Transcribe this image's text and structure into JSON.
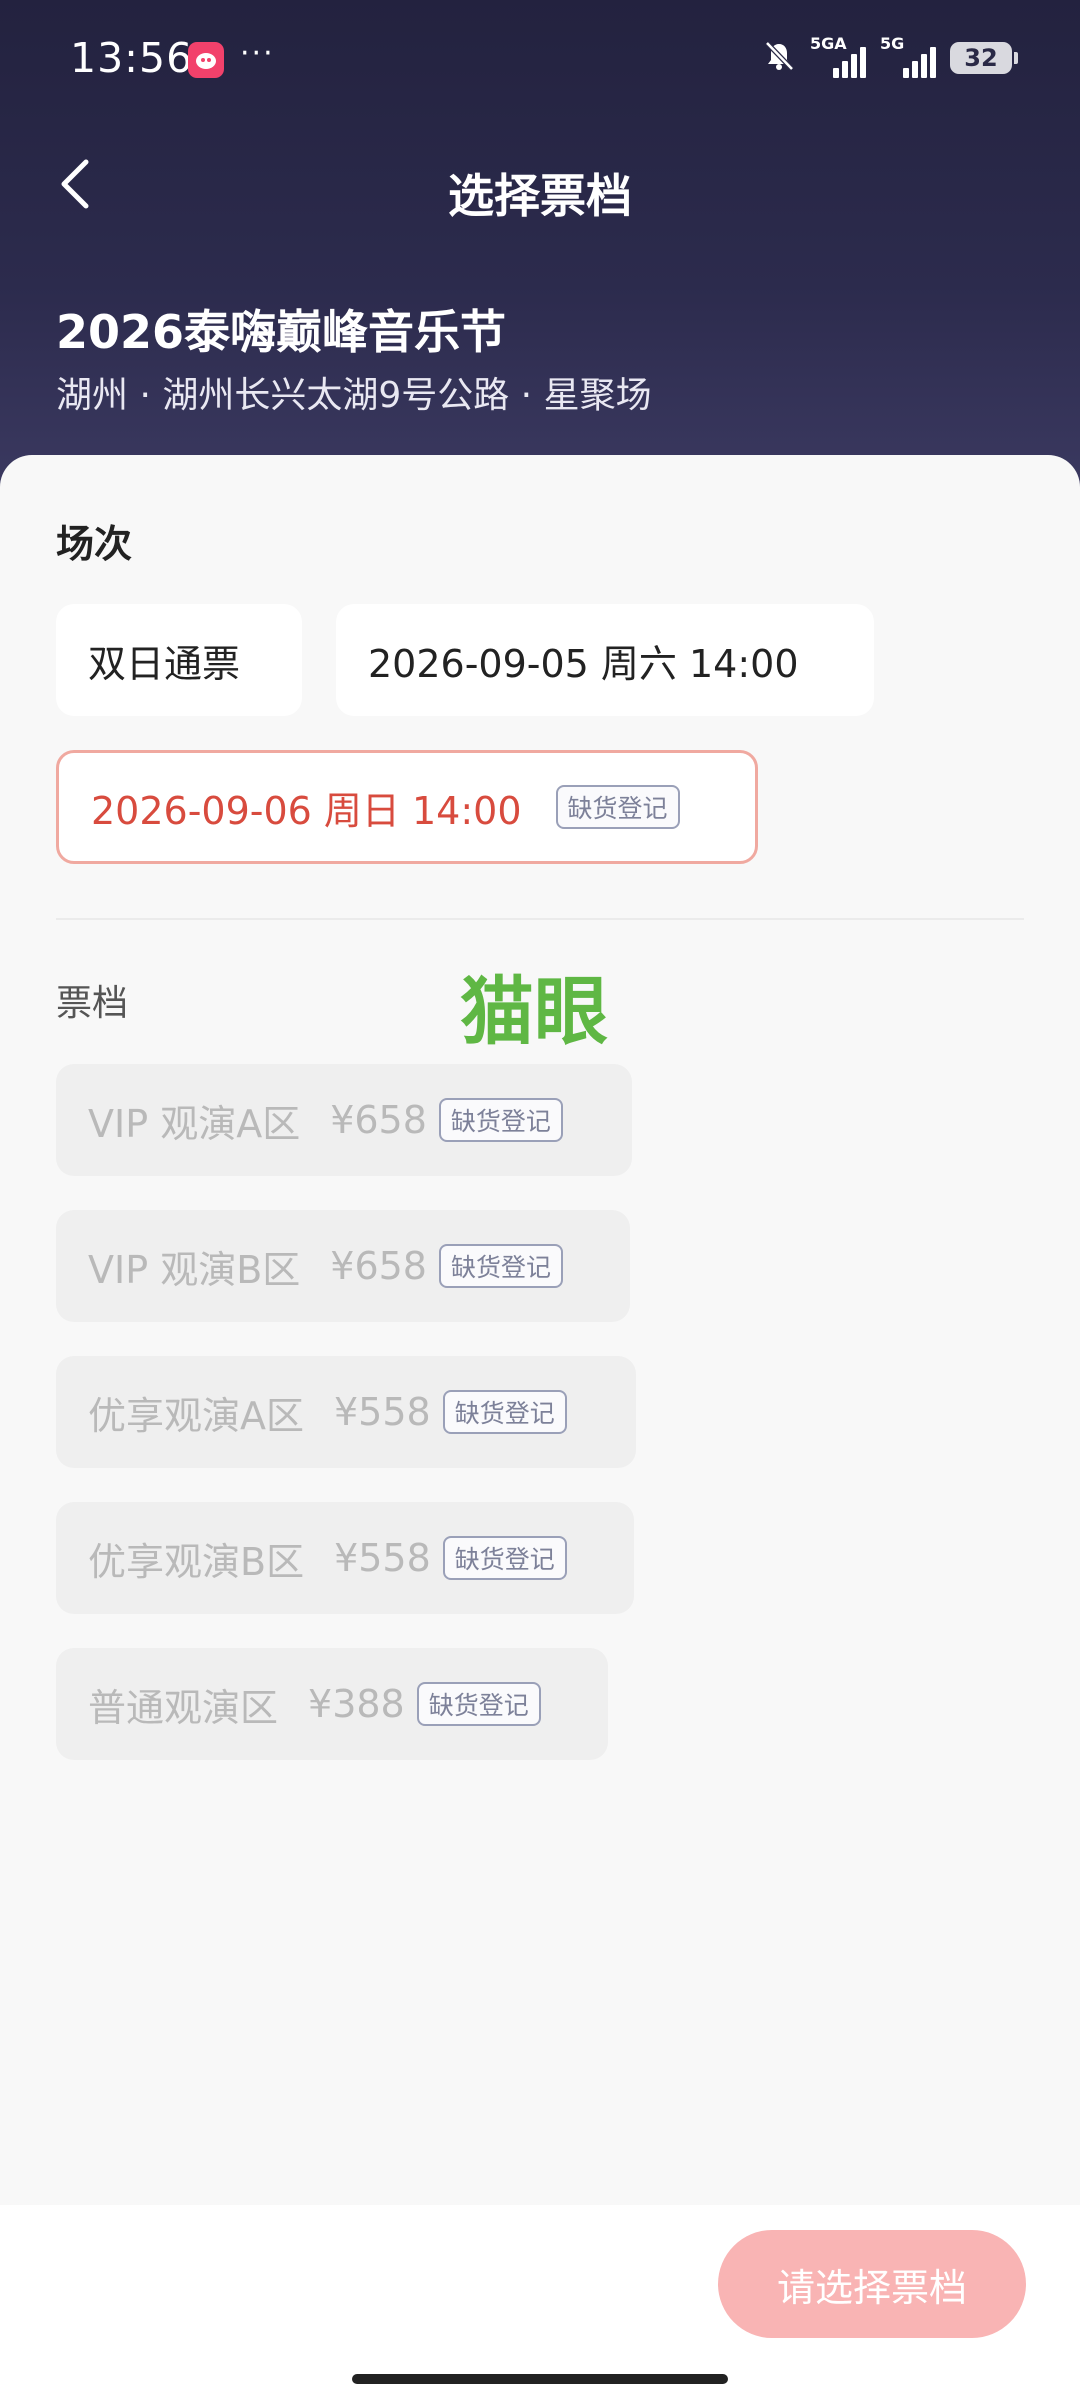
{
  "status_bar": {
    "time": "13:56",
    "more": "···",
    "signal1_label": "5GA",
    "signal2_label": "5G",
    "battery": "32"
  },
  "nav": {
    "title": "选择票档",
    "back_icon": "chevron-left-icon"
  },
  "event": {
    "title": "2026泰嗨巅峰音乐节",
    "venue": "湖州 · 湖州长兴太湖9号公路 · 星聚场"
  },
  "sessions": {
    "label": "场次",
    "items": [
      {
        "label": "双日通票",
        "selected": false,
        "badge": ""
      },
      {
        "label": "2026-09-05 周六 14:00",
        "selected": false,
        "badge": ""
      },
      {
        "label": "2026-09-06 周日 14:00",
        "selected": true,
        "badge": "缺货登记"
      }
    ]
  },
  "watermark": "猫眼",
  "tiers": {
    "label": "票档",
    "items": [
      {
        "name": "VIP 观演A区",
        "price": "¥658",
        "badge": "缺货登记"
      },
      {
        "name": "VIP 观演B区",
        "price": "¥658",
        "badge": "缺货登记"
      },
      {
        "name": "优享观演A区",
        "price": "¥558",
        "badge": "缺货登记"
      },
      {
        "name": "优享观演B区",
        "price": "¥558",
        "badge": "缺货登记"
      },
      {
        "name": "普通观演区",
        "price": "¥388",
        "badge": "缺货登记"
      }
    ]
  },
  "footer": {
    "confirm_label": "请选择票档"
  },
  "colors": {
    "header": "#2c2b4d",
    "accent_selected": "#d84b3e",
    "button": "#f9b4b4",
    "watermark": "#5fb744"
  }
}
